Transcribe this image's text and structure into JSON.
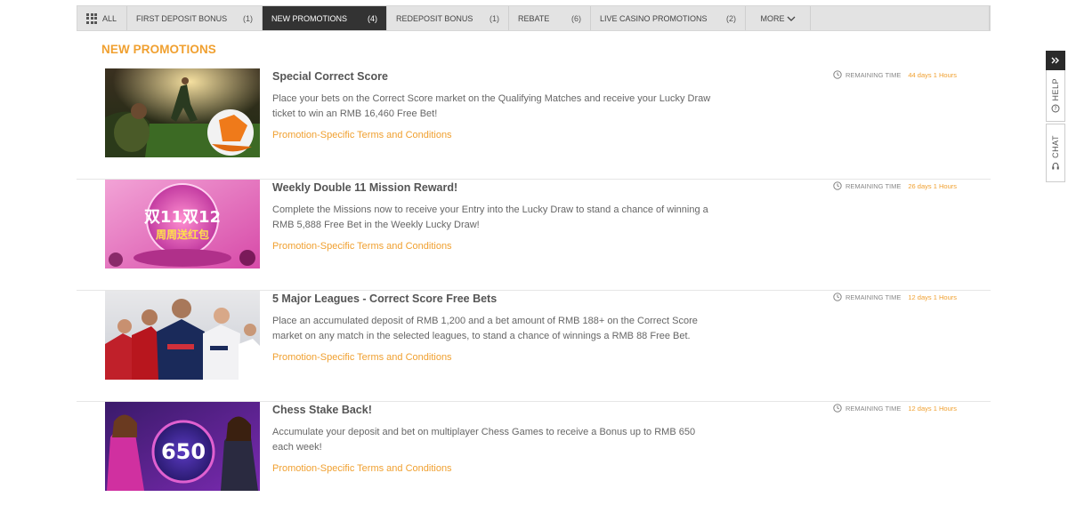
{
  "tabs": [
    {
      "label": "ALL",
      "count": ""
    },
    {
      "label": "FIRST DEPOSIT BONUS",
      "count": "(1)"
    },
    {
      "label": "NEW PROMOTIONS",
      "count": "(4)"
    },
    {
      "label": "REDEPOSIT BONUS",
      "count": "(1)"
    },
    {
      "label": "REBATE",
      "count": "(6)"
    },
    {
      "label": "LIVE CASINO PROMOTIONS",
      "count": "(2)"
    },
    {
      "label": "MORE",
      "count": ""
    }
  ],
  "active_tab": "NEW PROMOTIONS",
  "section_title": "NEW PROMOTIONS",
  "remaining_label": "REMAINING TIME",
  "promotions": [
    {
      "title": "Special Correct Score",
      "description": "Place your bets on the Correct Score market on the Qualifying Matches and receive your Lucky Draw ticket to win an RMB 16,460 Free Bet!",
      "link": "Promotion-Specific Terms and Conditions",
      "remaining": "44 days 1 Hours"
    },
    {
      "title": "Weekly Double 11 Mission Reward!",
      "description": "Complete the Missions now to receive your Entry into the Lucky Draw to stand a chance of winning a RMB 5,888 Free Bet in the Weekly Lucky Draw!",
      "link": "Promotion-Specific Terms and Conditions",
      "remaining": "26 days 1 Hours",
      "image_text": "双11双12 周周送红包"
    },
    {
      "title": "5 Major Leagues - Correct Score Free Bets",
      "description": "Place an accumulated deposit of RMB 1,200 and a bet amount of RMB 188+ on the Correct Score market on any match in the selected leagues, to stand a chance of winnings a RMB 88 Free Bet.",
      "link": "Promotion-Specific Terms and Conditions",
      "remaining": "12 days 1 Hours"
    },
    {
      "title": "Chess Stake Back!",
      "description": "Accumulate your deposit and bet on multiplayer Chess Games to receive a Bonus up to RMB 650 each week!",
      "link": "Promotion-Specific Terms and Conditions",
      "remaining": "12 days 1 Hours",
      "image_text": "650"
    }
  ],
  "side": {
    "help": "HELP",
    "chat": "CHAT"
  },
  "colors": {
    "accent": "#f0a030",
    "active_tab": "#333333",
    "tab_bar": "#e3e3e3"
  }
}
